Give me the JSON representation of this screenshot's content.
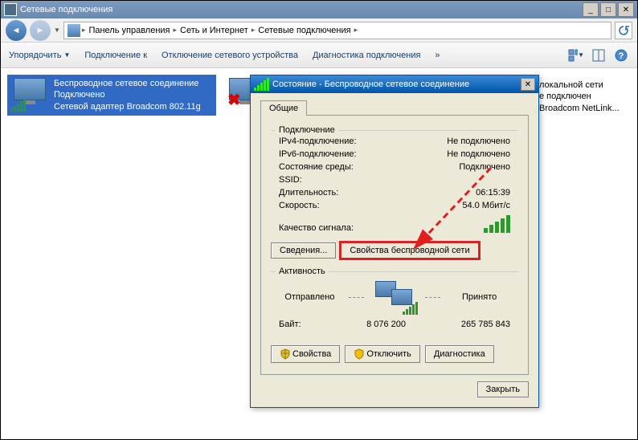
{
  "window": {
    "title": "Сетевые подключения"
  },
  "breadcrumb": {
    "items": [
      "Панель управления",
      "Сеть и Интернет",
      "Сетевые подключения"
    ]
  },
  "toolbar": {
    "organize": "Упорядочить",
    "connect": "Подключение к",
    "disable": "Отключение сетевого устройства",
    "diagnose": "Диагностика подключения",
    "more": "»"
  },
  "connections": [
    {
      "name": "Беспроводное сетевое соединение",
      "status": "Подключено",
      "adapter": "Сетевой адаптер Broadcom 802.11g"
    }
  ],
  "side_conn": {
    "line1": "локальной сети",
    "line2": "е подключен",
    "line3": "Broadcom NetLink..."
  },
  "dialog": {
    "title": "Состояние - Беспроводное сетевое соединение",
    "tab": "Общие",
    "group_connection": "Подключение",
    "rows": {
      "ipv4_label": "IPv4-подключение:",
      "ipv4_value": "Не подключено",
      "ipv6_label": "IPv6-подключение:",
      "ipv6_value": "Не подключено",
      "media_label": "Состояние среды:",
      "media_value": "Подключено",
      "ssid_label": "SSID:",
      "ssid_value": "",
      "duration_label": "Длительность:",
      "duration_value": "06:15:39",
      "speed_label": "Скорость:",
      "speed_value": "54.0 Мбит/с",
      "signal_label": "Качество сигнала:"
    },
    "btn_details": "Сведения...",
    "btn_wprops": "Свойства беспроводной сети",
    "group_activity": "Активность",
    "sent_label": "Отправлено",
    "recv_label": "Принято",
    "bytes_label": "Байт:",
    "bytes_sent": "8 076 200",
    "bytes_recv": "265 785 843",
    "btn_props": "Свойства",
    "btn_disable": "Отключить",
    "btn_diag": "Диагностика",
    "btn_close": "Закрыть"
  }
}
